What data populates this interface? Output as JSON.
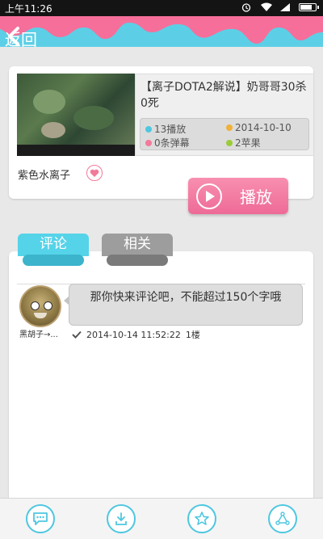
{
  "statusbar": {
    "time": "上午11:26"
  },
  "header": {
    "back_label": "返回"
  },
  "video": {
    "title": "【离子DOTA2解说】奶哥哥30杀0死",
    "plays": "13播放",
    "date": "2014-10-10",
    "danmaku": "0条弹幕",
    "apples": "2苹果",
    "author": "紫色水离子",
    "play_label": "播放"
  },
  "tabs": [
    {
      "label": "评论",
      "active": true
    },
    {
      "label": "相关",
      "active": false
    }
  ],
  "comments": [
    {
      "user": "黑胡子→...",
      "text": "那你快来评论吧，不能超过150个字哦",
      "timestamp": "2014-10-14 11:52:22",
      "floor": "1楼"
    }
  ],
  "bottom_nav": [
    "comment-icon",
    "download-icon",
    "star-icon",
    "share-icon"
  ],
  "colors": {
    "accent_cyan": "#55d3e9",
    "accent_pink": "#ee6b97",
    "tab_inactive": "#9d9d9d"
  }
}
